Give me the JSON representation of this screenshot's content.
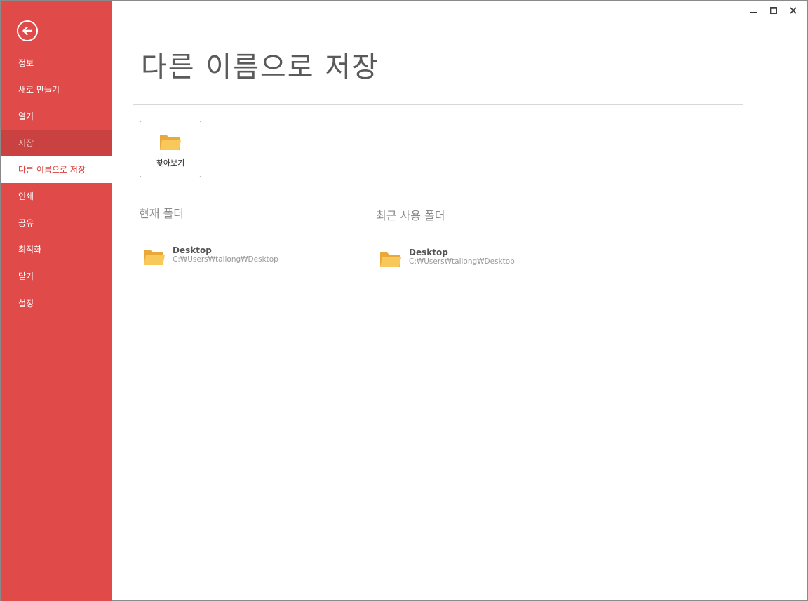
{
  "window": {
    "controls": {
      "minimize": "–",
      "maximize": "□",
      "close": "✕"
    }
  },
  "sidebar": {
    "back_icon": "back-arrow-icon",
    "items": [
      {
        "label": "정보"
      },
      {
        "label": "새로 만들기"
      },
      {
        "label": "열기"
      },
      {
        "label": "저장",
        "state": "hover"
      },
      {
        "label": "다른 이름으로 저장",
        "state": "active"
      },
      {
        "label": "인쇄"
      },
      {
        "label": "공유"
      },
      {
        "label": "최적화"
      },
      {
        "label": "닫기"
      },
      {
        "label": "설정"
      }
    ]
  },
  "main": {
    "title": "다른 이름으로 저장",
    "browse": {
      "label": "찾아보기",
      "icon": "folder-icon"
    },
    "current_folder": {
      "heading": "현재 폴더",
      "entry": {
        "name": "Desktop",
        "path": "C:₩Users₩tailong₩Desktop"
      }
    },
    "recent_folders": {
      "heading": "최근 사용 폴더",
      "entry": {
        "name": "Desktop",
        "path": "C:₩Users₩tailong₩Desktop"
      }
    }
  },
  "colors": {
    "sidebar_bg": "#e04a48",
    "sidebar_hover": "#c94140",
    "active_text": "#d9413f",
    "folder_yellow": "#f9c85a"
  }
}
